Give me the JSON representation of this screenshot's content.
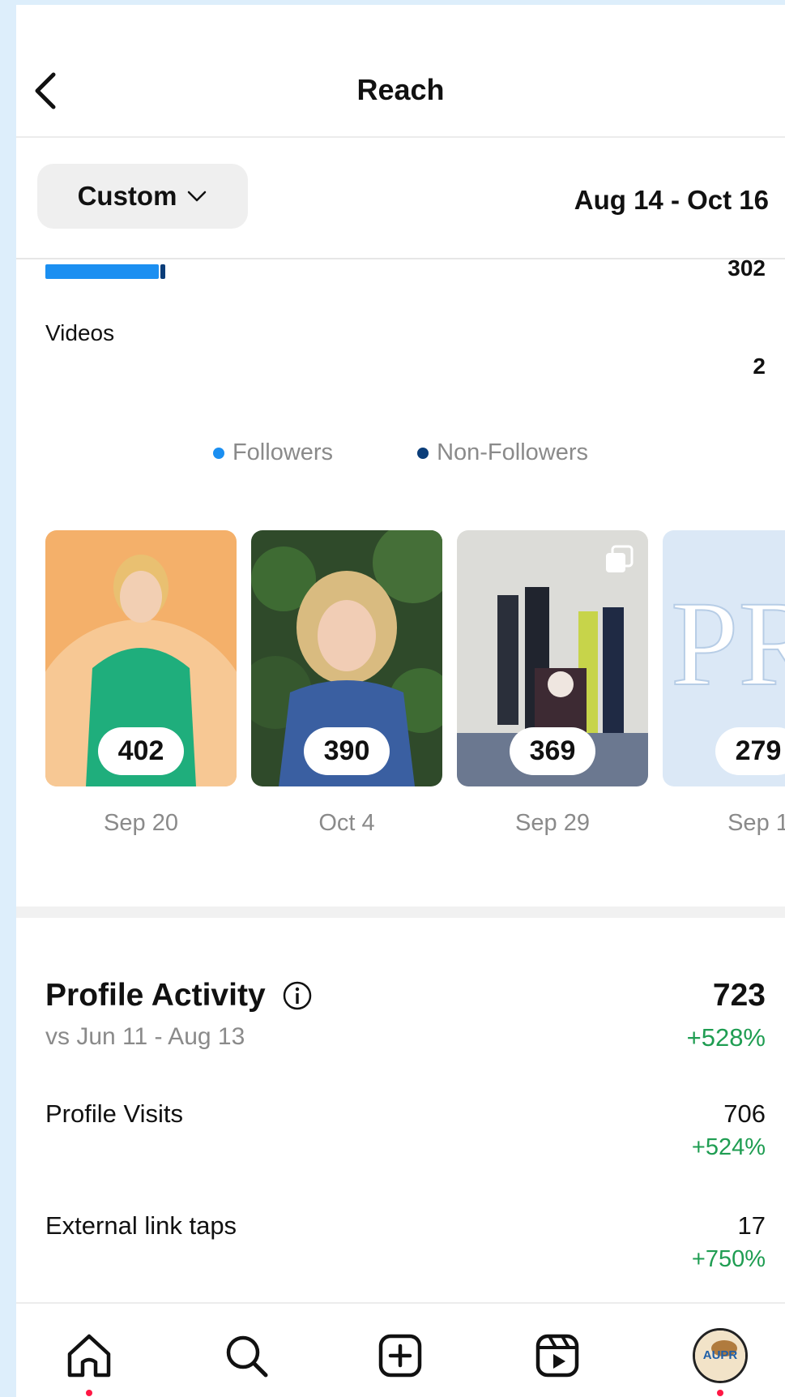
{
  "header": {
    "title": "Reach",
    "back_icon": "chevron-left-icon"
  },
  "filter": {
    "period_label": "Custom",
    "chevron_icon": "chevron-down-icon",
    "date_range": "Aug 14 - Oct 16"
  },
  "reach_breakdown": {
    "top_value": "302",
    "videos_label": "Videos",
    "videos_value": "2",
    "colors": {
      "followers": "#1b8ff1",
      "non_followers": "#0b3d79"
    }
  },
  "legend": {
    "followers": "Followers",
    "non_followers": "Non-Followers"
  },
  "top_content": [
    {
      "reach": "402",
      "date": "Sep 20"
    },
    {
      "reach": "390",
      "date": "Oct 4"
    },
    {
      "reach": "369",
      "date": "Sep 29"
    },
    {
      "reach": "279",
      "date": "Sep 1"
    }
  ],
  "profile_activity": {
    "title": "Profile Activity",
    "info_icon": "info-icon",
    "comparison": "vs Jun 11 - Aug 13",
    "total": "723",
    "total_change": "+528%",
    "rows": [
      {
        "label": "Profile Visits",
        "value": "706",
        "change": "+524%"
      },
      {
        "label": "External link taps",
        "value": "17",
        "change": "+750%"
      }
    ]
  },
  "nav": {
    "items": [
      "home-icon",
      "search-icon",
      "create-icon",
      "reels-icon",
      "profile-avatar"
    ],
    "avatar_text": "AUPR"
  },
  "accent_colors": {
    "positive": "#1f9d52",
    "notification": "#ff1744"
  }
}
